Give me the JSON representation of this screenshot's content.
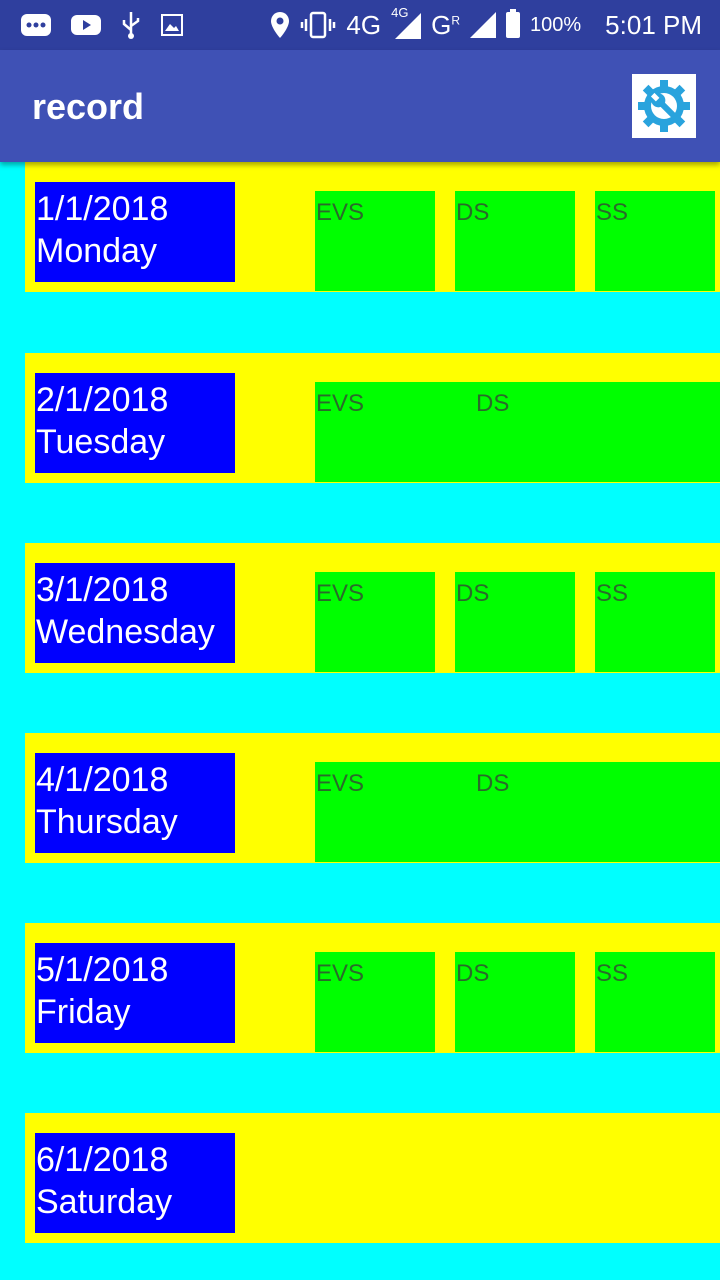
{
  "status_bar": {
    "network_primary": "4G",
    "network_secondary": "4G",
    "network_g": "G",
    "network_g_sup": "R",
    "battery": "100%",
    "time": "5:01 PM"
  },
  "app_bar": {
    "title": "record",
    "settings_icon": "settings-wrench-gear-icon"
  },
  "colors": {
    "row_background": "#ffff00",
    "date_box": "#0000ff",
    "subject_box": "#00ff00",
    "page_background": "#00ffff",
    "app_bar": "#3f51b5"
  },
  "days": [
    {
      "date": "1/1/2018",
      "day": "Monday",
      "subjects": [
        "EVS",
        "DS",
        "SS"
      ]
    },
    {
      "date": "2/1/2018",
      "day": "Tuesday",
      "subjects": [
        "EVS",
        "DS"
      ]
    },
    {
      "date": "3/1/2018",
      "day": "Wednesday",
      "subjects": [
        "EVS",
        "DS",
        "SS"
      ]
    },
    {
      "date": "4/1/2018",
      "day": "Thursday",
      "subjects": [
        "EVS",
        "DS"
      ]
    },
    {
      "date": "5/1/2018",
      "day": "Friday",
      "subjects": [
        "EVS",
        "DS",
        "SS"
      ]
    },
    {
      "date": "6/1/2018",
      "day": "Saturday",
      "subjects": []
    }
  ]
}
